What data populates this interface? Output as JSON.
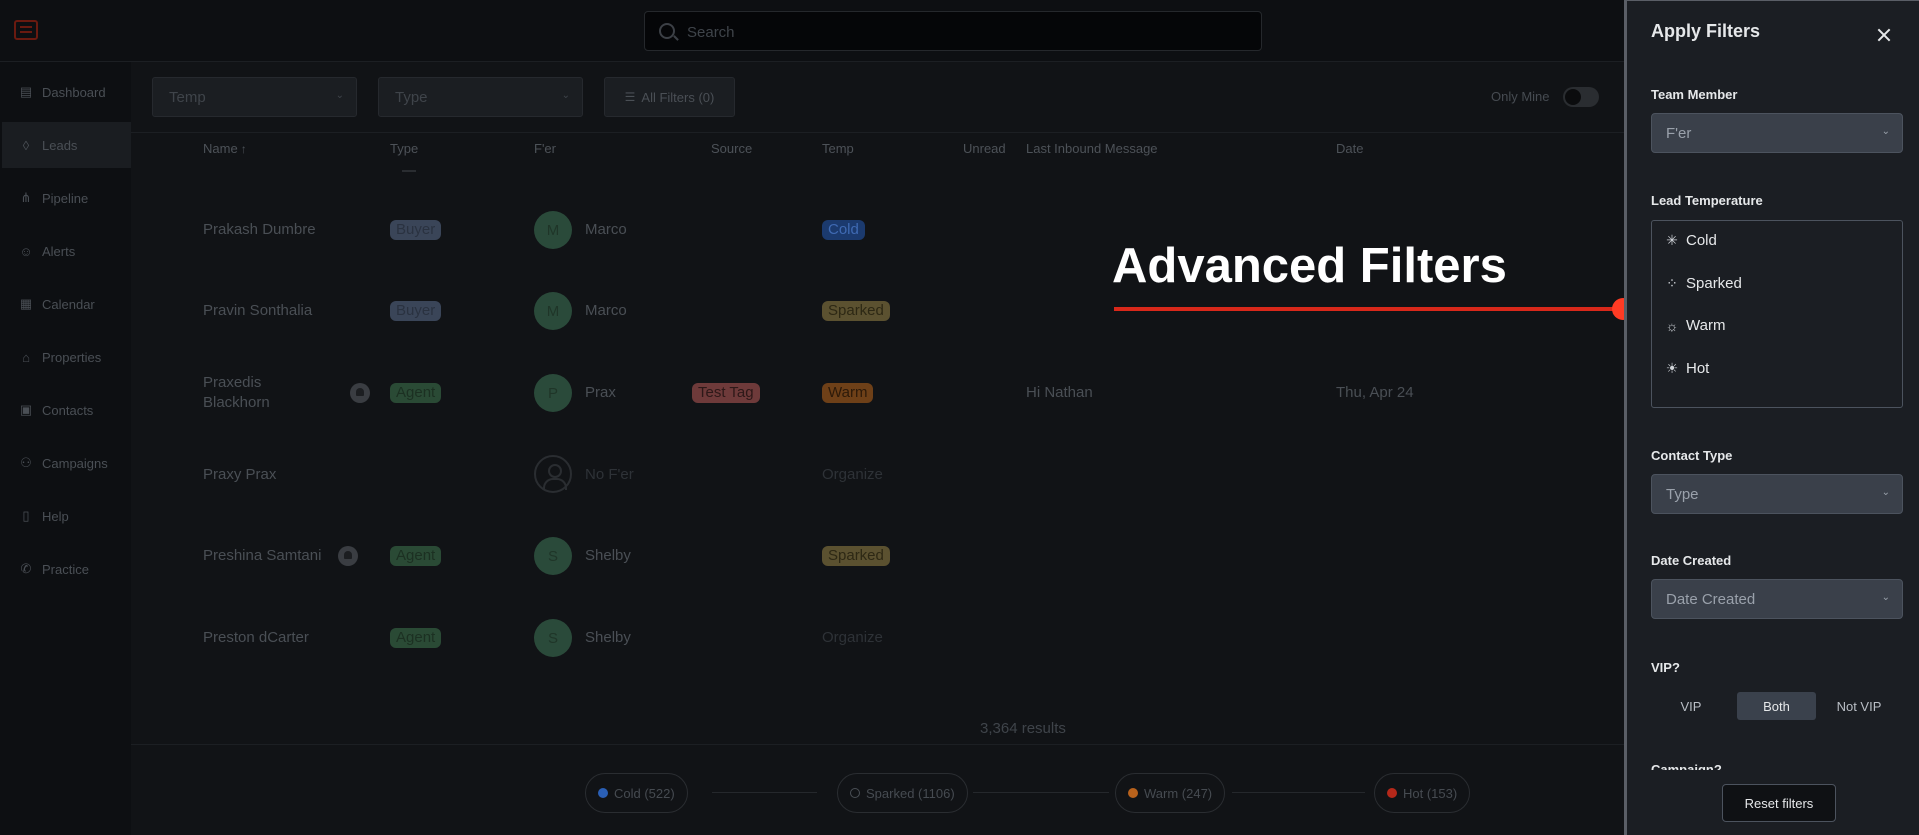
{
  "search": {
    "placeholder": "Search"
  },
  "sidebar": {
    "items": [
      {
        "label": "Dashboard",
        "icon": "chart-icon"
      },
      {
        "label": "Leads",
        "icon": "flame-icon"
      },
      {
        "label": "Pipeline",
        "icon": "pipeline-icon"
      },
      {
        "label": "Alerts",
        "icon": "alerts-icon"
      },
      {
        "label": "Calendar",
        "icon": "calendar-icon"
      },
      {
        "label": "Properties",
        "icon": "home-icon"
      },
      {
        "label": "Contacts",
        "icon": "contact-icon"
      },
      {
        "label": "Campaigns",
        "icon": "campaigns-icon"
      },
      {
        "label": "Help",
        "icon": "book-icon"
      },
      {
        "label": "Practice",
        "icon": "phone-icon"
      }
    ]
  },
  "filters": {
    "temp_placeholder": "Temp",
    "type_placeholder": "Type",
    "all_filters_label": "All Filters (0)",
    "only_mine_label": "Only Mine"
  },
  "table": {
    "headers": [
      "Name",
      "Type",
      "F'er",
      "Source",
      "Temp",
      "Unread",
      "Last Inbound Message",
      "Date"
    ],
    "rows": [
      {
        "name": "Prakash Dumbre",
        "type": "Buyer",
        "initial": "M",
        "fer": "Marco",
        "source": "",
        "temp": "Cold",
        "message": "",
        "date": ""
      },
      {
        "name": "Pravin Sonthalia",
        "type": "Buyer",
        "initial": "M",
        "fer": "Marco",
        "source": "",
        "temp": "Sparked",
        "message": "",
        "date": ""
      },
      {
        "name_line1": "Praxedis",
        "name_line2": "Blackhorn",
        "type": "Agent",
        "initial": "P",
        "fer": "Prax",
        "source": "Test Tag",
        "temp": "Warm",
        "message": "Hi Nathan",
        "date": "Thu, Apr 24"
      },
      {
        "name": "Praxy Prax",
        "type": "",
        "initial": "",
        "fer": "No F'er",
        "source": "",
        "temp": "Organize",
        "message": "",
        "date": ""
      },
      {
        "name": "Preshina Samtani",
        "type": "Agent",
        "initial": "S",
        "fer": "Shelby",
        "source": "",
        "temp": "Sparked",
        "message": "",
        "date": ""
      },
      {
        "name": "Preston dCarter",
        "type": "Agent",
        "initial": "S",
        "fer": "Shelby",
        "source": "",
        "temp": "Organize",
        "message": "",
        "date": ""
      }
    ]
  },
  "results_label": "3,364 results",
  "temperature_summary": [
    {
      "label": "Cold (522)",
      "color": "#2a5fb5"
    },
    {
      "label": "Sparked (1106)",
      "color": "#4a4f55"
    },
    {
      "label": "Warm (247)",
      "color": "#b8621c"
    },
    {
      "label": "Hot (153)",
      "color": "#b5281a"
    }
  ],
  "annotation": {
    "text": "Advanced Filters",
    "color": "#ff3b24"
  },
  "panel": {
    "title": "Apply Filters",
    "team_member_label": "Team Member",
    "team_member_value": "F'er",
    "lead_temperature_label": "Lead Temperature",
    "temperatures": [
      {
        "label": "Cold",
        "icon": "snowflake-icon"
      },
      {
        "label": "Sparked",
        "icon": "sparkle-icon"
      },
      {
        "label": "Warm",
        "icon": "sun-icon"
      },
      {
        "label": "Hot",
        "icon": "hot-sun-icon"
      }
    ],
    "contact_type_label": "Contact Type",
    "contact_type_value": "Type",
    "date_created_label": "Date Created",
    "date_created_value": "Date Created",
    "vip_label": "VIP?",
    "vip_options": [
      "VIP",
      "Both",
      "Not VIP"
    ],
    "vip_selected": "Both",
    "next_label_partial": "Campaign?",
    "reset_label": "Reset filters"
  }
}
